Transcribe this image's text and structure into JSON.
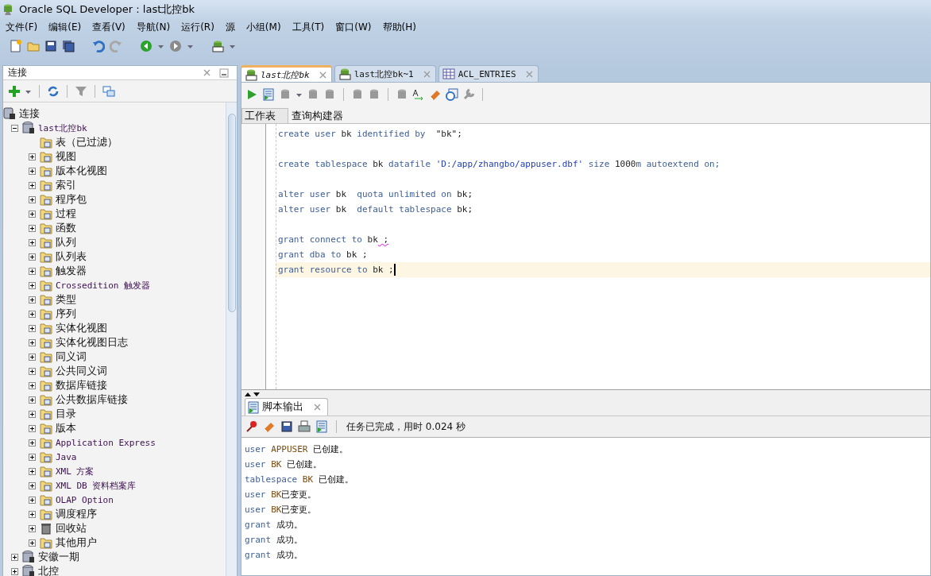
{
  "window": {
    "title": "Oracle SQL Developer : last北控bk"
  },
  "menu": [
    "文件(F)",
    "编辑(E)",
    "查看(V)",
    "导航(N)",
    "运行(R)",
    "源",
    "小组(M)",
    "工具(T)",
    "窗口(W)",
    "帮助(H)"
  ],
  "connections_panel": {
    "title": "连接",
    "tree": [
      {
        "label": "连接",
        "kind": "root",
        "children": [
          {
            "label": "last北控bk",
            "kind": "database",
            "expanded": true,
            "children": [
              {
                "label": "表（已过滤）",
                "kind": "leaf-folder"
              },
              {
                "label": "视图",
                "kind": "folder",
                "expanded": false
              },
              {
                "label": "版本化视图",
                "kind": "folder",
                "expanded": false
              },
              {
                "label": "索引",
                "kind": "folder",
                "expanded": false
              },
              {
                "label": "程序包",
                "kind": "folder",
                "expanded": false
              },
              {
                "label": "过程",
                "kind": "folder",
                "expanded": false
              },
              {
                "label": "函数",
                "kind": "folder",
                "expanded": false
              },
              {
                "label": "队列",
                "kind": "folder",
                "expanded": false
              },
              {
                "label": "队列表",
                "kind": "folder",
                "expanded": false
              },
              {
                "label": "触发器",
                "kind": "folder",
                "expanded": false
              },
              {
                "label": "Crossedition 触发器",
                "kind": "folder",
                "expanded": false
              },
              {
                "label": "类型",
                "kind": "folder",
                "expanded": false
              },
              {
                "label": "序列",
                "kind": "folder",
                "expanded": false
              },
              {
                "label": "实体化视图",
                "kind": "folder",
                "expanded": false
              },
              {
                "label": "实体化视图日志",
                "kind": "folder",
                "expanded": false
              },
              {
                "label": "同义词",
                "kind": "folder",
                "expanded": false
              },
              {
                "label": "公共同义词",
                "kind": "folder",
                "expanded": false
              },
              {
                "label": "数据库链接",
                "kind": "folder",
                "expanded": false
              },
              {
                "label": "公共数据库链接",
                "kind": "folder",
                "expanded": false
              },
              {
                "label": "目录",
                "kind": "folder",
                "expanded": false
              },
              {
                "label": "版本",
                "kind": "folder",
                "expanded": false
              },
              {
                "label": "Application Express",
                "kind": "folder",
                "expanded": false
              },
              {
                "label": "Java",
                "kind": "folder",
                "expanded": false
              },
              {
                "label": "XML 方案",
                "kind": "folder",
                "expanded": false
              },
              {
                "label": "XML DB 资料档案库",
                "kind": "folder",
                "expanded": false
              },
              {
                "label": "OLAP Option",
                "kind": "folder",
                "expanded": false
              },
              {
                "label": "调度程序",
                "kind": "folder",
                "expanded": false
              },
              {
                "label": "回收站",
                "kind": "trash",
                "expanded": false
              },
              {
                "label": "其他用户",
                "kind": "folder",
                "expanded": false
              }
            ]
          },
          {
            "label": "安徽一期",
            "kind": "database",
            "expanded": false
          },
          {
            "label": "北控",
            "kind": "database",
            "expanded": false
          }
        ]
      }
    ]
  },
  "editor_tabs": [
    {
      "label": "last北控bk",
      "kind": "sql",
      "selected": true
    },
    {
      "label": "last北控bk~1",
      "kind": "sql",
      "selected": false
    },
    {
      "label": "ACL_ENTRIES",
      "kind": "table",
      "selected": false
    }
  ],
  "sub_tabs": [
    {
      "label": "工作表",
      "selected": true
    },
    {
      "label": "查询构建器",
      "selected": false
    }
  ],
  "code_lines": [
    {
      "kind": "code",
      "current": false,
      "tokens": [
        {
          "text": "create user ",
          "kind": "kw"
        },
        {
          "text": "bk ",
          "kind": "id"
        },
        {
          "text": "identified by  ",
          "kind": "kw"
        },
        {
          "text": "\"bk\";",
          "kind": "id"
        }
      ]
    },
    {
      "kind": "blank",
      "current": false
    },
    {
      "kind": "code",
      "current": false,
      "tokens": [
        {
          "text": "create tablespace ",
          "kind": "kw"
        },
        {
          "text": "bk ",
          "kind": "id"
        },
        {
          "text": "datafile ",
          "kind": "kw"
        },
        {
          "text": "'D:/app/zhangbo/appuser.dbf'",
          "kind": "str"
        },
        {
          "text": " size ",
          "kind": "kw"
        },
        {
          "text": "1000",
          "kind": "id"
        },
        {
          "text": "m autoextend on;",
          "kind": "kw"
        }
      ]
    },
    {
      "kind": "blank",
      "current": false
    },
    {
      "kind": "code",
      "current": false,
      "tokens": [
        {
          "text": "alter user ",
          "kind": "kw"
        },
        {
          "text": "bk  ",
          "kind": "id"
        },
        {
          "text": "quota unlimited on ",
          "kind": "kw"
        },
        {
          "text": "bk;",
          "kind": "id"
        }
      ]
    },
    {
      "kind": "code",
      "current": false,
      "tokens": [
        {
          "text": "alter user ",
          "kind": "kw"
        },
        {
          "text": "bk  ",
          "kind": "id"
        },
        {
          "text": "default tablespace ",
          "kind": "kw"
        },
        {
          "text": "bk;",
          "kind": "id"
        }
      ]
    },
    {
      "kind": "blank",
      "current": false
    },
    {
      "kind": "code",
      "current": false,
      "tokens": [
        {
          "text": "grant connect to ",
          "kind": "kw"
        },
        {
          "text": "bk",
          "kind": "id"
        },
        {
          "text": " ;",
          "kind": "flagged"
        }
      ]
    },
    {
      "kind": "code",
      "current": false,
      "tokens": [
        {
          "text": "grant dba to ",
          "kind": "kw"
        },
        {
          "text": "bk ;",
          "kind": "id"
        }
      ]
    },
    {
      "kind": "code",
      "current": true,
      "tokens": [
        {
          "text": "grant resource to ",
          "kind": "kw"
        },
        {
          "text": "bk ;",
          "kind": "id"
        }
      ]
    }
  ],
  "output_panel": {
    "tab": "脚本输出",
    "status": "任务已完成，用时 0.024 秒",
    "lines": [
      [
        {
          "text": "user ",
          "kind": "kw"
        },
        {
          "text": "APPUSER",
          "kind": "obj"
        },
        {
          "text": " 已创建。",
          "kind": "text"
        }
      ],
      [
        {
          "text": "user ",
          "kind": "kw"
        },
        {
          "text": "BK",
          "kind": "obj"
        },
        {
          "text": " 已创建。",
          "kind": "text"
        }
      ],
      [
        {
          "text": "tablespace ",
          "kind": "kw"
        },
        {
          "text": "BK",
          "kind": "obj"
        },
        {
          "text": " 已创建。",
          "kind": "text"
        }
      ],
      [
        {
          "text": "user ",
          "kind": "kw"
        },
        {
          "text": "BK",
          "kind": "obj"
        },
        {
          "text": "已变更。",
          "kind": "text"
        }
      ],
      [
        {
          "text": "user ",
          "kind": "kw"
        },
        {
          "text": "BK",
          "kind": "obj"
        },
        {
          "text": "已变更。",
          "kind": "text"
        }
      ],
      [
        {
          "text": "grant ",
          "kind": "kw"
        },
        {
          "text": "成功。",
          "kind": "text"
        }
      ],
      [
        {
          "text": "grant ",
          "kind": "kw"
        },
        {
          "text": "成功。",
          "kind": "text"
        }
      ],
      [
        {
          "text": "grant ",
          "kind": "kw"
        },
        {
          "text": "成功。",
          "kind": "text"
        }
      ]
    ]
  }
}
